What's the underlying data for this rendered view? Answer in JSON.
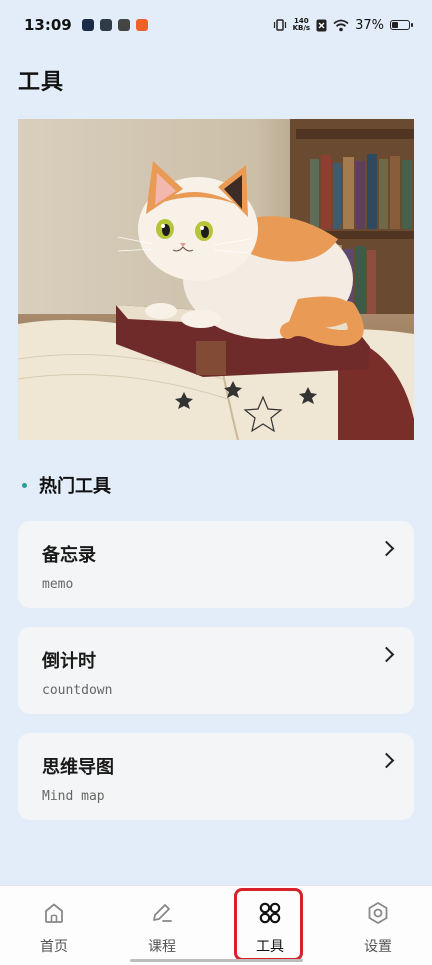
{
  "status_bar": {
    "time": "13:09",
    "net_speed_value": "140",
    "net_speed_unit": "KB/s",
    "battery": "37%",
    "battery_level": 0.37
  },
  "page": {
    "title": "工具"
  },
  "section": {
    "title": "热门工具"
  },
  "tools": [
    {
      "title": "备忘录",
      "subtitle": "memo"
    },
    {
      "title": "倒计时",
      "subtitle": "countdown"
    },
    {
      "title": "思维导图",
      "subtitle": "Mind map"
    }
  ],
  "nav": {
    "items": [
      {
        "label": "首页",
        "icon": "home-icon"
      },
      {
        "label": "课程",
        "icon": "edit-icon"
      },
      {
        "label": "工具",
        "icon": "tools-icon"
      },
      {
        "label": "设置",
        "icon": "settings-icon"
      }
    ],
    "active_index": 2
  },
  "colors": {
    "background": "#e3edf9",
    "card": "#f4f5f6",
    "accent_dot": "#2a9d8f",
    "highlight": "#d8202a"
  }
}
